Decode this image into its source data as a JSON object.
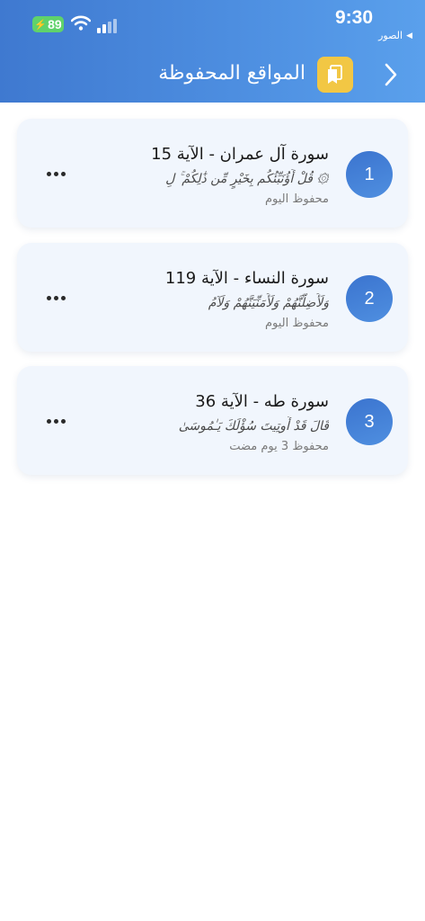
{
  "status_bar": {
    "time": "9:30",
    "back_label": "الصور",
    "battery": "89"
  },
  "header": {
    "title": "المواقع المحفوظة"
  },
  "bookmarks": [
    {
      "number": "1",
      "title": "سورة آل عمران - الآية 15",
      "excerpt": "۞ قُلْ أَؤُنَبِّئُكُم بِخَيْرٍ مِّن ذَٰلِكُمْ ۚ لِ",
      "date": "محفوظ اليوم"
    },
    {
      "number": "2",
      "title": "سورة النساء - الآية 119",
      "excerpt": "وَلَأُضِلَّنَّهُمْ وَلَأُمَنِّيَنَّهُمْ وَلَآمُ",
      "date": "محفوظ اليوم"
    },
    {
      "number": "3",
      "title": "سورة طه - الآية 36",
      "excerpt": "قَالَ قَدْ أُوتِيتَ سُؤْلَكَ يَـٰمُوسَىٰ",
      "date": "محفوظ 3 يوم مضت"
    }
  ],
  "colors": {
    "header_start": "#3f79d0",
    "header_end": "#5aa0ec",
    "title_icon_bg": "#f2c744",
    "card_bg": "#f1f6fd",
    "badge": "#3b74cf"
  }
}
